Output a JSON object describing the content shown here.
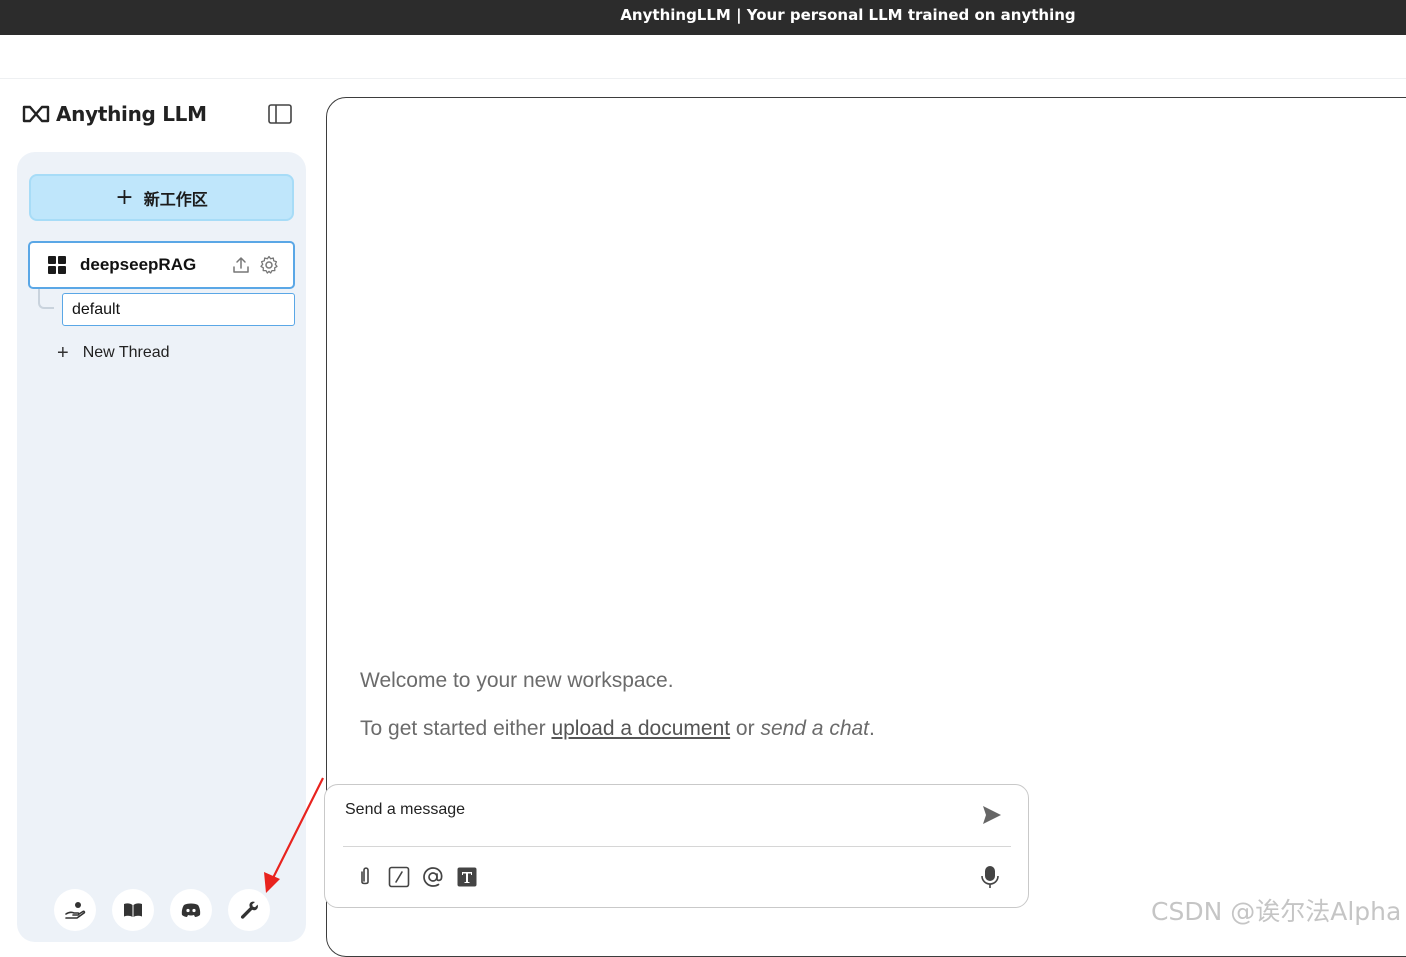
{
  "window": {
    "title": "AnythingLLM | Your personal LLM trained on anything"
  },
  "sidebar": {
    "logo_text": "Anything LLM",
    "new_workspace_label": "新工作区",
    "workspace": {
      "name": "deepseepRAG",
      "icon": "grid-icon"
    },
    "threads": [
      {
        "label": "default",
        "selected": true
      }
    ],
    "new_thread_label": "New Thread",
    "footer_icons": [
      "community-hub-icon",
      "docs-book-icon",
      "discord-icon",
      "settings-wrench-icon"
    ]
  },
  "main": {
    "welcome_line": "Welcome to your new workspace.",
    "started_prefix": "To get started either ",
    "upload_link": "upload a document",
    "started_middle": " or ",
    "send_chat": "send a chat",
    "started_suffix": ".",
    "input": {
      "placeholder": "Send a message",
      "tools": [
        "attach-icon",
        "slash-command-icon",
        "at-mention-icon",
        "text-format-icon"
      ]
    }
  },
  "watermark": "CSDN @诶尔法Alpha",
  "colors": {
    "accent_blue": "#5aa7e6",
    "new_ws_bg": "#bfe6fb",
    "sidebar_bg": "#edf2f8",
    "annotation_arrow": "#e8231e"
  }
}
